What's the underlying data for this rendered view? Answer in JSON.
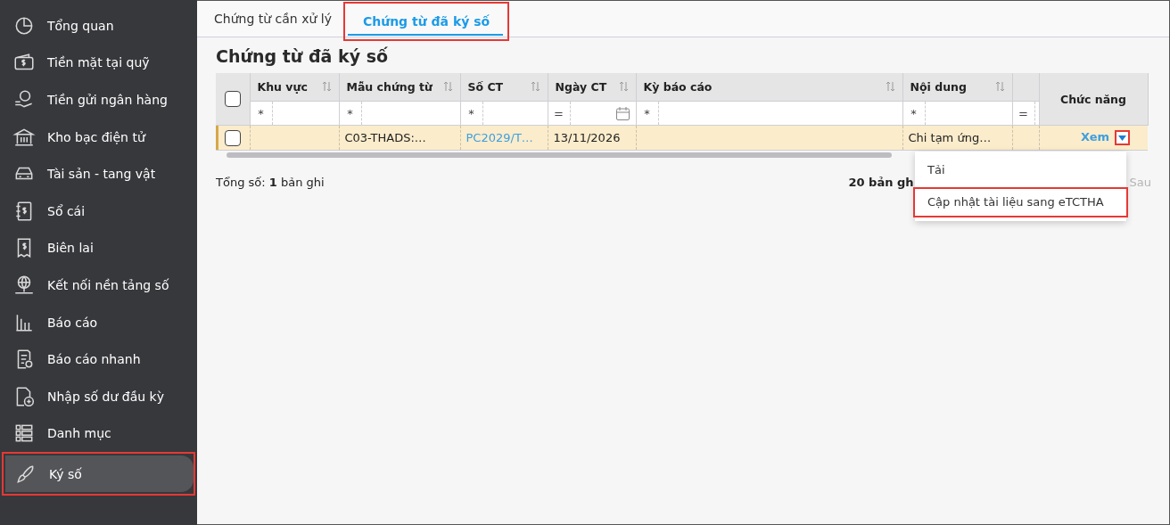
{
  "sidebar": {
    "items": [
      {
        "label": "Tổng quan",
        "selected": false,
        "highlighted": false
      },
      {
        "label": "Tiền mặt tại quỹ",
        "selected": false,
        "highlighted": false
      },
      {
        "label": "Tiền gửi ngân hàng",
        "selected": false,
        "highlighted": false
      },
      {
        "label": "Kho bạc điện tử",
        "selected": false,
        "highlighted": false
      },
      {
        "label": "Tài sản - tang vật",
        "selected": false,
        "highlighted": false
      },
      {
        "label": "Sổ cái",
        "selected": false,
        "highlighted": false
      },
      {
        "label": "Biên lai",
        "selected": false,
        "highlighted": false
      },
      {
        "label": "Kết nối nền tảng số",
        "selected": false,
        "highlighted": false
      },
      {
        "label": "Báo cáo",
        "selected": false,
        "highlighted": false
      },
      {
        "label": "Báo cáo nhanh",
        "selected": false,
        "highlighted": false
      },
      {
        "label": "Nhập số dư đầu kỳ",
        "selected": false,
        "highlighted": false
      },
      {
        "label": "Danh mục",
        "selected": false,
        "highlighted": false
      },
      {
        "label": "Ký số",
        "selected": true,
        "highlighted": true
      }
    ]
  },
  "tabs": [
    {
      "label": "Chứng từ cần xử lý",
      "selected": false,
      "highlighted": false
    },
    {
      "label": "Chứng từ đã ký số",
      "selected": true,
      "highlighted": true
    }
  ],
  "page_title": "Chứng từ đã ký số",
  "table": {
    "select_all_checked": false,
    "columns": [
      {
        "label": "Khu vực",
        "sortable": true,
        "filter": "*",
        "kind": "text"
      },
      {
        "label": "Mẫu chứng từ",
        "sortable": true,
        "filter": "*",
        "kind": "text"
      },
      {
        "label": "Số CT",
        "sortable": true,
        "filter": "*",
        "kind": "text"
      },
      {
        "label": "Ngày CT",
        "sortable": true,
        "filter": "=",
        "kind": "date"
      },
      {
        "label": "Kỳ báo cáo",
        "sortable": true,
        "filter": "*",
        "kind": "text"
      },
      {
        "label": "Nội dung",
        "sortable": true,
        "filter": "*",
        "kind": "text"
      },
      {
        "sortable": false,
        "filter": "=",
        "kind": "text"
      }
    ],
    "action_column": "Chức năng",
    "rows": [
      {
        "checked": false,
        "active": true,
        "cells": [
          null,
          {
            "text": "C03-THADS:…",
            "link": false
          },
          {
            "text": "PC2029/T…",
            "link": true
          },
          {
            "text": "13/11/2026",
            "link": false
          },
          null,
          {
            "text": "Chi tạm ứng…",
            "link": false
          },
          null
        ],
        "action": "Xem",
        "menu_open": true,
        "caret_highlighted": true
      }
    ]
  },
  "footer": {
    "total": "Tổng số: **1** bản ghi",
    "page_size": "20 bản gh",
    "next": "Sau",
    "next_disabled": true
  },
  "menu": {
    "items": [
      {
        "label": "Tải",
        "highlighted": false
      },
      {
        "label": "Cập nhật tài liệu sang eTCTHA",
        "highlighted": true
      }
    ]
  }
}
